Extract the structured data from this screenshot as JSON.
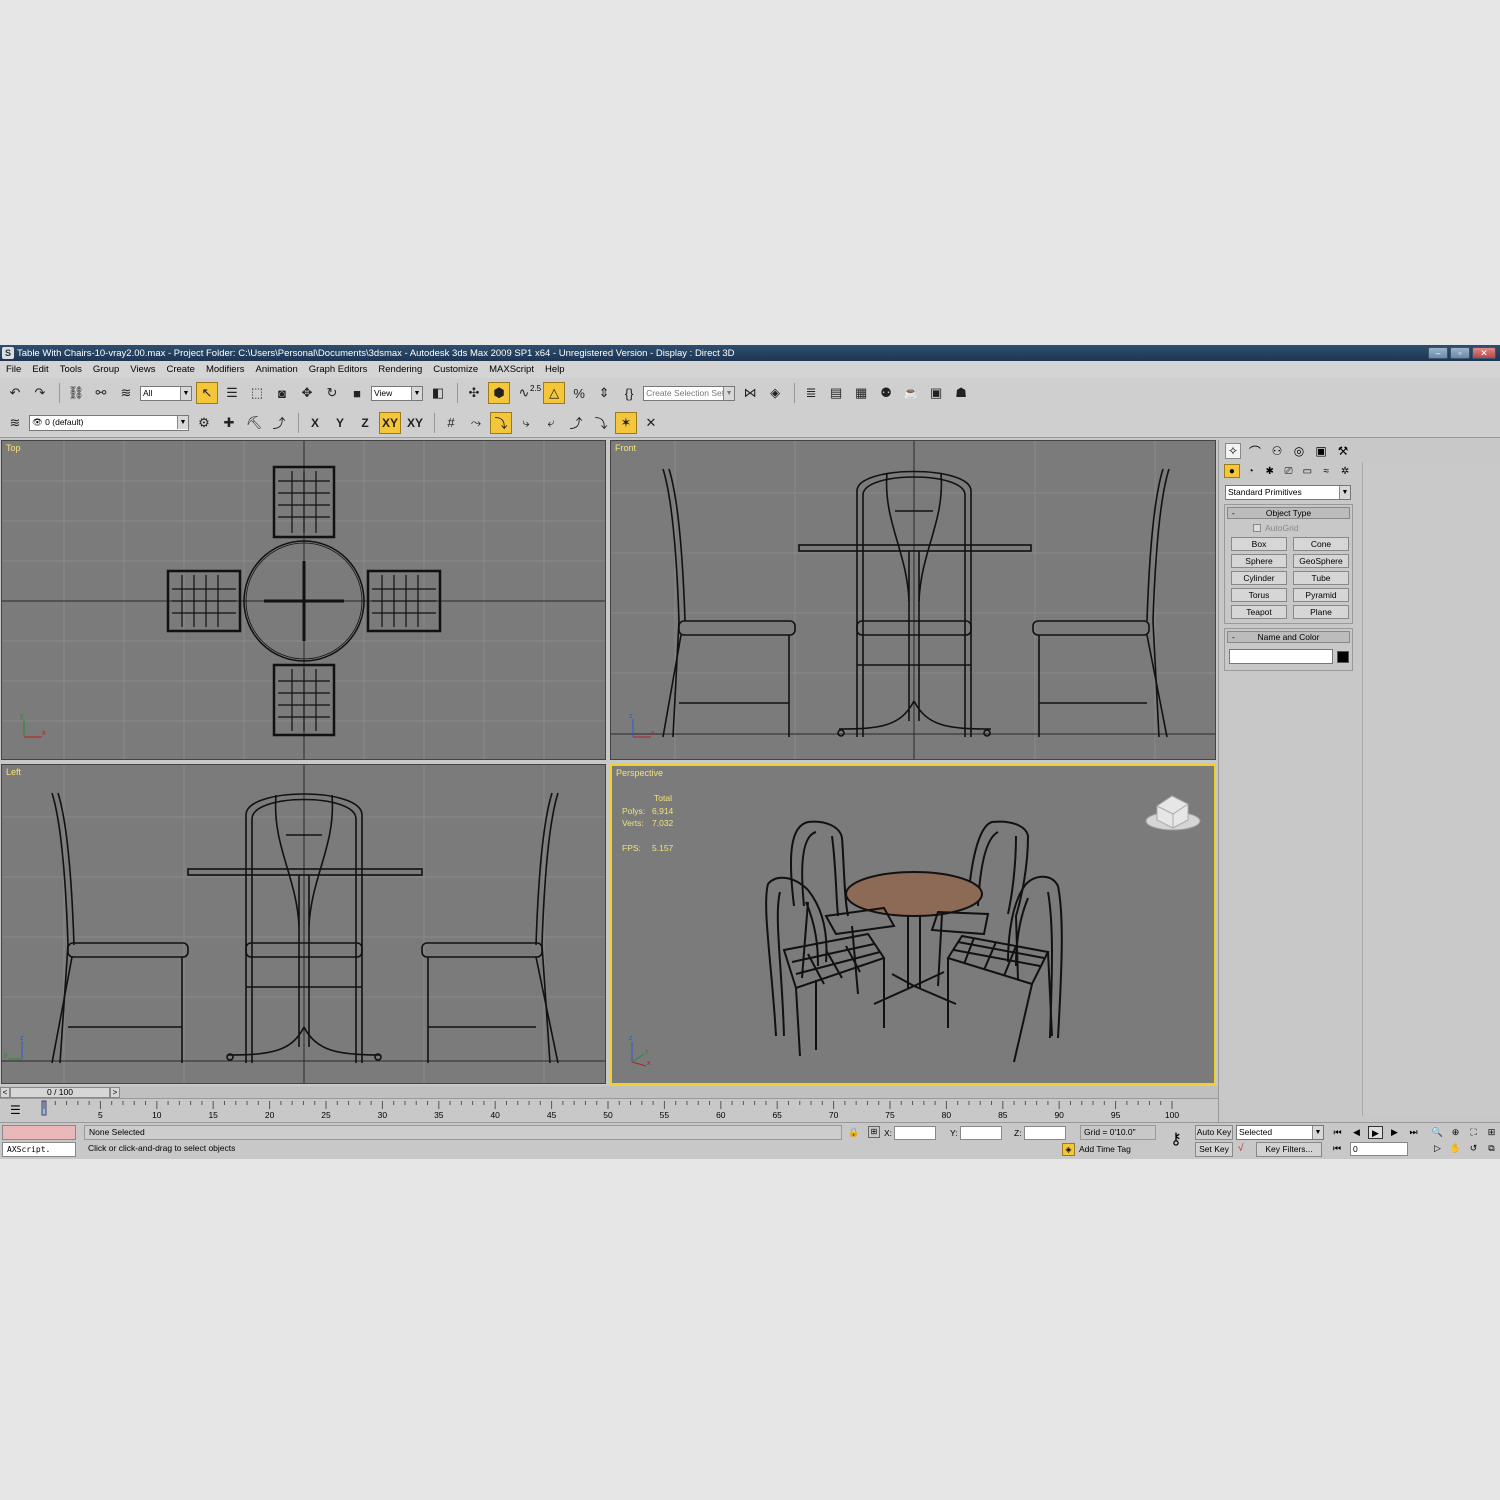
{
  "window": {
    "title": "Table With Chairs-10-vray2.00.max      - Project Folder: C:\\Users\\Personal\\Documents\\3dsmax      - Autodesk 3ds Max  2009 SP1  x64  - Unregistered Version      - Display : Direct 3D",
    "app_icon": "3ds-max-icon"
  },
  "menu": [
    "File",
    "Edit",
    "Tools",
    "Group",
    "Views",
    "Create",
    "Modifiers",
    "Animation",
    "Graph Editors",
    "Rendering",
    "Customize",
    "MAXScript",
    "Help"
  ],
  "toolbar": {
    "selection_filter": "All",
    "ref_coord": "View",
    "snap_value": "2.5",
    "named_selection_placeholder": "Create Selection Set"
  },
  "layer_bar": {
    "layer": "0 (default)",
    "axis_x": "X",
    "axis_y": "Y",
    "axis_z": "Z",
    "axis_xy": "XY",
    "axis_xy2": "XY"
  },
  "viewports": {
    "top": "Top",
    "front": "Front",
    "left": "Left",
    "perspective": "Perspective"
  },
  "stats": {
    "header": "Total",
    "polys_label": "Polys:",
    "polys": "6,914",
    "verts_label": "Verts:",
    "verts": "7,032",
    "fps_label": "FPS:",
    "fps": "5.157"
  },
  "command_panel": {
    "category": "Standard Primitives",
    "object_type_title": "Object Type",
    "autogrid": "AutoGrid",
    "objects": [
      "Box",
      "Cone",
      "Sphere",
      "GeoSphere",
      "Cylinder",
      "Tube",
      "Torus",
      "Pyramid",
      "Teapot",
      "Plane"
    ],
    "name_color_title": "Name and Color",
    "minus": "-"
  },
  "time_slider": {
    "frame": "0 / 100",
    "prev": "<",
    "next": ">",
    "ticks": [
      "5",
      "10",
      "15",
      "20",
      "25",
      "30",
      "35",
      "40",
      "45",
      "50",
      "55",
      "60",
      "65",
      "70",
      "75",
      "80",
      "85",
      "90",
      "95",
      "100"
    ]
  },
  "status": {
    "selection": "None Selected",
    "prompt": "Click or click-and-drag to select objects",
    "maxscript": "AXScript.",
    "x_label": "X:",
    "y_label": "Y:",
    "z_label": "Z:",
    "grid": "Grid = 0'10.0\"",
    "add_time_tag": "Add Time Tag",
    "auto_key": "Auto Key",
    "set_key": "Set Key",
    "key_mode": "Selected",
    "key_filters": "Key Filters...",
    "current_frame": "0"
  },
  "colors": {
    "viewport_bg": "#7b7b7b",
    "active_border": "#f0d12a",
    "label_yellow": "#f3e37b",
    "table_top": "#8c6a55"
  }
}
